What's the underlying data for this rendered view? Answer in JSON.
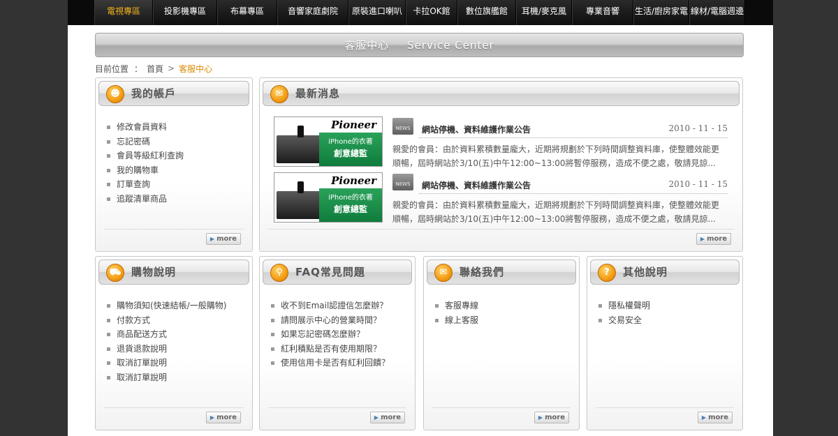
{
  "nav": {
    "items": [
      {
        "label": "電視專區",
        "active": true
      },
      {
        "label": "投影機專區",
        "active": false
      },
      {
        "label": "布幕專區",
        "active": false
      },
      {
        "label": "音響家庭劇院",
        "active": false
      },
      {
        "label": "原裝進口喇叭",
        "active": false
      },
      {
        "label": "卡拉OK館",
        "active": false
      },
      {
        "label": "數位旗艦館",
        "active": false
      },
      {
        "label": "耳機/麥克風",
        "active": false
      },
      {
        "label": "專業音響",
        "active": false
      },
      {
        "label": "生活/廚房家電",
        "active": false
      },
      {
        "label": "線材/電腦週邊",
        "active": false
      }
    ]
  },
  "header": {
    "title_cn": "客服中心",
    "title_en": "Service Center"
  },
  "breadcrumb": {
    "label": "目前位置",
    "colon": "：",
    "home": "首頁",
    "sep": ">",
    "current": "客服中心"
  },
  "more_label": "more",
  "account": {
    "title": "我的帳戶",
    "items": [
      "修改會員資料",
      "忘記密碼",
      "會員等級紅利查詢",
      "我的購物車",
      "訂單查詢",
      "追蹤清單商品"
    ]
  },
  "news": {
    "title": "最新消息",
    "badge": "NEWS",
    "items": [
      {
        "title": "網站停機、資料維護作業公告",
        "date": "2010 - 11 - 15",
        "body": "親愛的會員：由於資料累積數量龐大，近期將規劃於下列時間調整資料庫，使整體效能更順暢，屆時網站於3/10(五)中午12:00~13:00將暫停服務，造成不便之處，敬請見諒...",
        "thumb": {
          "brand": "Pioneer",
          "line1": "iPhone的衣著",
          "line2": "創意總監"
        }
      },
      {
        "title": "網站停機、資料維護作業公告",
        "date": "2010 - 11 - 15",
        "body": "親愛的會員：由於資料累積數量龐大，近期將規劃於下列時間調整資料庫，使整體效能更順暢，屆時網站於3/10(五)中午12:00~13:00將暫停服務，造成不便之處，敬請見諒...",
        "thumb": {
          "brand": "Pioneer",
          "line1": "iPhone的衣著",
          "line2": "創意總監"
        }
      }
    ]
  },
  "shopping": {
    "title": "購物說明",
    "items": [
      "購物須知(快速結帳/一般購物)",
      "付款方式",
      "商品配送方式",
      "退貨退款說明",
      "取消訂單說明",
      "取消訂單說明"
    ]
  },
  "faq": {
    "title": "FAQ常見問題",
    "items": [
      "收不到Email認證信怎麼辦？",
      "請問展示中心的營業時間？",
      "如果忘記密碼怎麼辦？",
      "紅利積點是否有使用期限？",
      "使用信用卡是否有紅利回饋？"
    ]
  },
  "contact": {
    "title": "聯絡我們",
    "items": [
      "客服專線",
      "線上客服"
    ]
  },
  "other": {
    "title": "其他說明",
    "items": [
      "隱私權聲明",
      "交易安全"
    ]
  }
}
